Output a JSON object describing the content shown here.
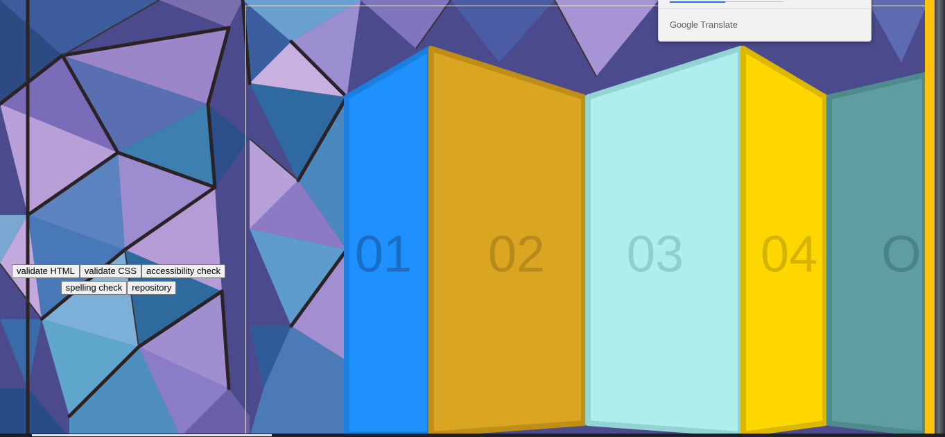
{
  "tools": {
    "validate_html": "validate HTML",
    "validate_css": "validate CSS",
    "accessibility_check": "accessibility check",
    "spelling_check": "spelling check",
    "repository": "repository"
  },
  "translate_widget": {
    "brand_google": "Google",
    "brand_translate": "Translate"
  },
  "panels": [
    {
      "label": "01",
      "color": "#1e90ff",
      "edge": "#1b7fe0",
      "text": "#1a6cc4"
    },
    {
      "label": "02",
      "color": "#daa520",
      "edge": "#bf8e17",
      "text": "#b88a1a"
    },
    {
      "label": "03",
      "color": "#afeeee",
      "edge": "#93d3d3",
      "text": "#8fcfcf"
    },
    {
      "label": "04",
      "color": "#ffd700",
      "edge": "#dcb800",
      "text": "#d4b400"
    },
    {
      "label": "O",
      "color": "#5f9ea0",
      "edge": "#4f8a8c",
      "text": "#4a8385"
    }
  ],
  "accent_color": "#ffc20e"
}
